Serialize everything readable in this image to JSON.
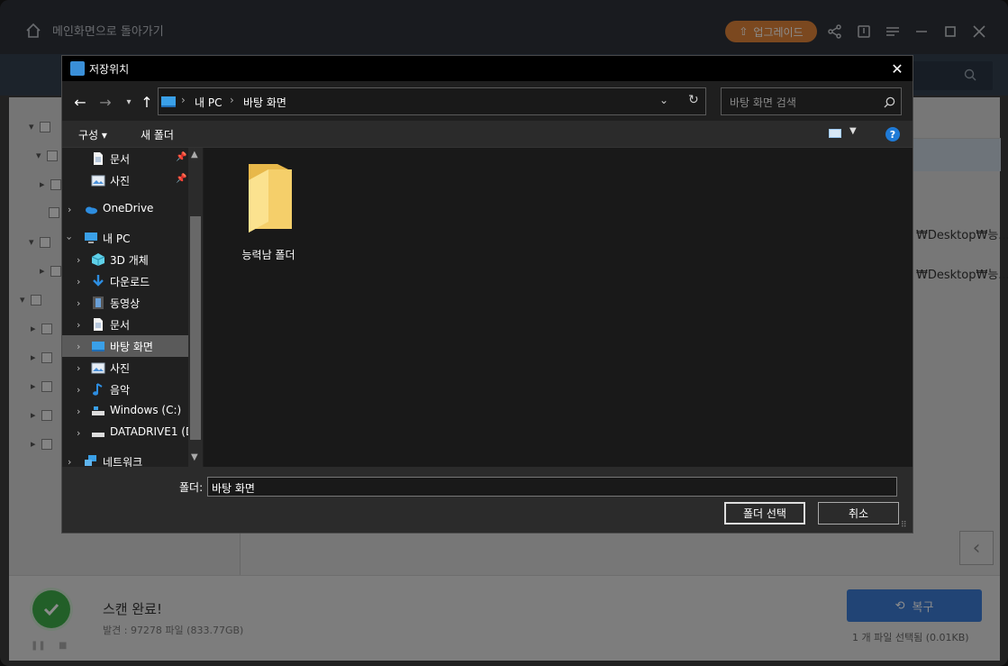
{
  "app": {
    "home_label": "메인화면으로 돌아가기",
    "upgrade_label": "업그레이드",
    "paths": [
      "₩Desktop₩능...",
      "₩Desktop₩능..."
    ],
    "scan_title": "스캔 완료!",
    "scan_sub": "발견 : 97278 파일 (833.77GB)",
    "recover_label": "복구",
    "selection_info": "1 개 파일 선택됨 (0.01KB)"
  },
  "dialog": {
    "title": "저장위치",
    "breadcrumb": [
      "내 PC",
      "바탕 화면"
    ],
    "search_placeholder": "바탕 화면 검색",
    "organize_label": "구성 ▾",
    "new_folder_label": "새 폴더",
    "help_label": "?",
    "nav": [
      {
        "label": "문서",
        "icon": "document-icon",
        "pinned": true
      },
      {
        "label": "사진",
        "icon": "pictures-icon",
        "pinned": true
      },
      {
        "label": "OneDrive",
        "icon": "onedrive-icon"
      },
      {
        "label": "내 PC",
        "icon": "pc-icon"
      },
      {
        "label": "3D 개체",
        "icon": "3d-objects-icon"
      },
      {
        "label": "다운로드",
        "icon": "download-icon"
      },
      {
        "label": "동영상",
        "icon": "video-icon"
      },
      {
        "label": "문서",
        "icon": "document-icon"
      },
      {
        "label": "바탕 화면",
        "icon": "desktop-icon",
        "selected": true
      },
      {
        "label": "사진",
        "icon": "pictures-icon"
      },
      {
        "label": "음악",
        "icon": "music-icon"
      },
      {
        "label": "Windows  (C:)",
        "icon": "drive-c-icon"
      },
      {
        "label": "DATADRIVE1 (D",
        "icon": "drive-d-icon"
      },
      {
        "label": "네트워크",
        "icon": "network-icon"
      }
    ],
    "folders": [
      {
        "label": "능력남 폴더"
      }
    ],
    "folder_field_label": "폴더:",
    "folder_field_value": "바탕 화면",
    "select_folder_label": "폴더 선택",
    "cancel_label": "취소"
  }
}
